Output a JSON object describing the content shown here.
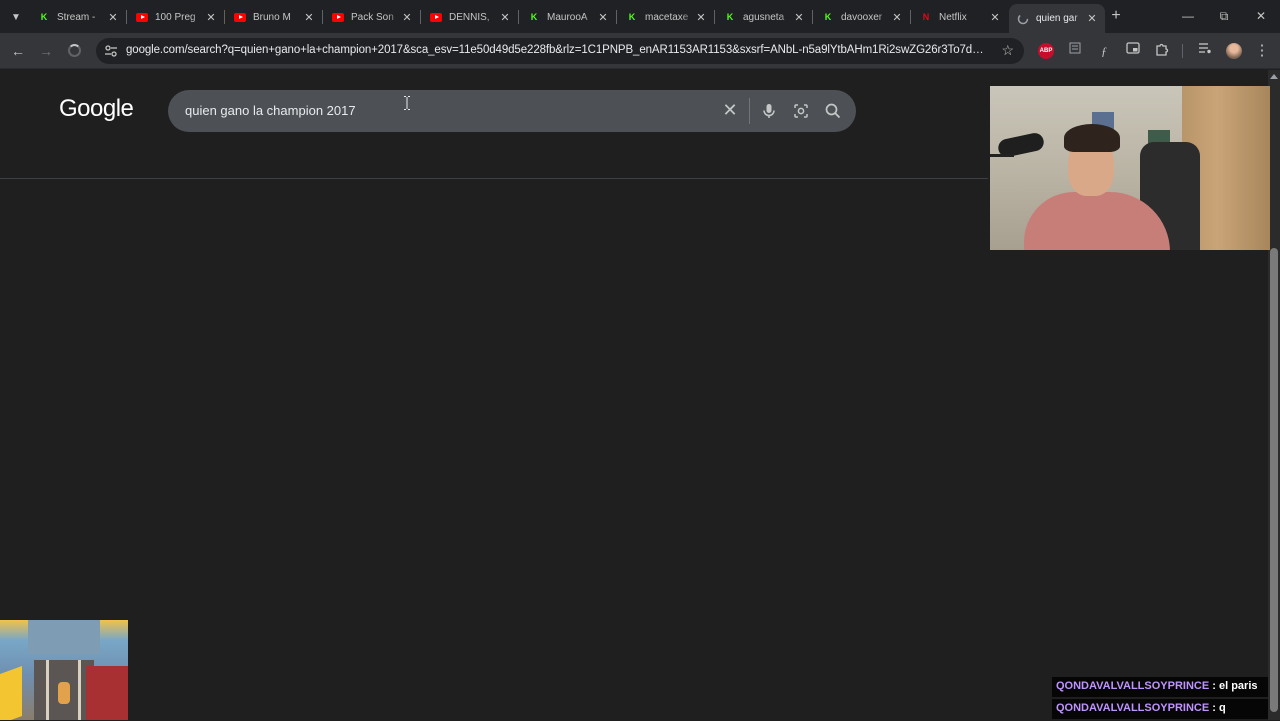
{
  "tabs": [
    {
      "title": "Stream -",
      "favicon": "kick-icon"
    },
    {
      "title": "100 Preg",
      "favicon": "youtube-icon"
    },
    {
      "title": "Bruno M",
      "favicon": "youtube-icon"
    },
    {
      "title": "Pack Son",
      "favicon": "youtube-icon"
    },
    {
      "title": "DENNIS,",
      "favicon": "youtube-icon"
    },
    {
      "title": "MaurooA",
      "favicon": "kick-icon"
    },
    {
      "title": "macetaxe",
      "favicon": "kick-icon"
    },
    {
      "title": "agusneta",
      "favicon": "kick-icon"
    },
    {
      "title": "davooxer",
      "favicon": "kick-icon"
    },
    {
      "title": "Netflix",
      "favicon": "netflix-icon"
    },
    {
      "title": "quien gar",
      "favicon": "loading-icon",
      "active": true
    }
  ],
  "address_bar": {
    "url": "google.com/search?q=quien+gano+la+champion+2017&sca_esv=11e50d49d5e228fb&rlz=1C1PNPB_enAR1153AR1153&sxsrf=ANbL-n5a9lYtbAHm1Ri2swZG26r3To7d5w%..."
  },
  "google": {
    "logo_text": "Google",
    "search_query": "quien gano la champion 2017"
  },
  "stream_chat": [
    {
      "user": "QONDAVALVALLSOYPRINCE",
      "message": ": el paris"
    },
    {
      "user": "QONDAVALVALLSOYPRINCE",
      "message": ": q"
    }
  ],
  "colors": {
    "kick_green": "#53fc18",
    "youtube_red": "#ff0000",
    "netflix_red": "#e50914",
    "chat_username": "#bf94ff"
  }
}
